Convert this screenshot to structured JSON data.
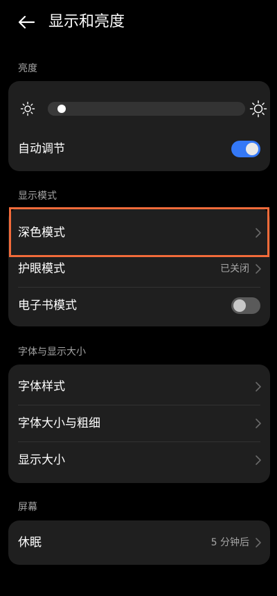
{
  "header": {
    "title": "显示和亮度",
    "back_icon": "arrow-left-icon"
  },
  "brightness": {
    "section_label": "亮度",
    "level": 0.03,
    "auto_label": "自动调节",
    "auto_on": true,
    "accent_color": "#3478f6"
  },
  "display_mode": {
    "section_label": "显示模式",
    "dark_mode_label": "深色模式",
    "eye_care_label": "护眼模式",
    "eye_care_value": "已关闭",
    "ebook_label": "电子书模式",
    "ebook_on": false
  },
  "font_display": {
    "section_label": "字体与显示大小",
    "font_style_label": "字体样式",
    "font_size_label": "字体大小与粗细",
    "display_size_label": "显示大小"
  },
  "screen": {
    "section_label": "屏幕",
    "sleep_label": "休眠",
    "sleep_value": "5 分钟后"
  },
  "highlight_color": "#f26b3a"
}
